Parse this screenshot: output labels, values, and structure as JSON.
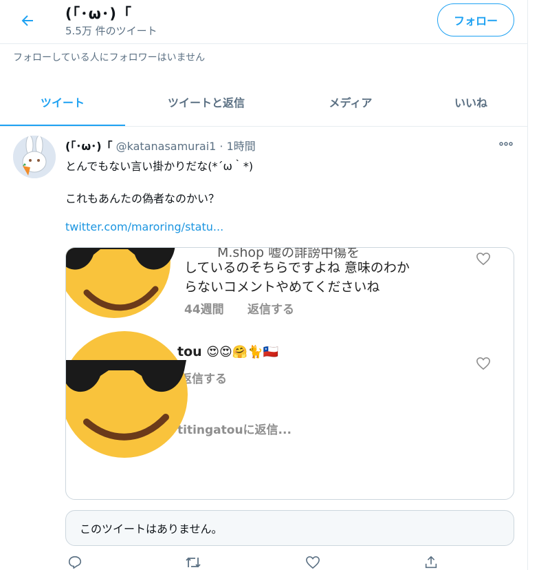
{
  "header": {
    "title": "(「･ω･)「",
    "tweet_count": "5.5万 件のツイート",
    "follow_label": "フォロー"
  },
  "followers_note": "フォローしている人にフォロワーはいません",
  "tabs": [
    {
      "label": "ツイート",
      "active": true
    },
    {
      "label": "ツイートと返信",
      "active": false
    },
    {
      "label": "メディア",
      "active": false
    },
    {
      "label": "いいね",
      "active": false
    }
  ],
  "tweet": {
    "author": "(「･ω･)「",
    "handle": "@katanasamurai1",
    "time": "1時間",
    "line1": "とんでもない言い掛かりだな(*´ω｀*)",
    "line2": "これもあんたの偽者なのかい？",
    "link": "twitter.com/maroring/statu...",
    "media": {
      "top_cut": "M.shop 嘘の誹謗中傷を",
      "comment_line1": "しているのそちらですよね 意味のわか",
      "comment_line2": "らないコメントやめてくださいね",
      "meta_time": "44週間",
      "reply1": "返信する",
      "user2": "tou",
      "reply2": "返信する",
      "reply_to": "titingatouに返信..."
    },
    "quote_unavailable": "このツイートはありません。"
  },
  "colors": {
    "accent": "#1da1f2",
    "link": "#1b95e0",
    "secondary_text": "#5b7083",
    "border": "#e6ecf0"
  },
  "icons": [
    "back-arrow-icon",
    "more-icon",
    "heart-icon",
    "reply-icon",
    "retweet-icon",
    "like-icon",
    "share-icon"
  ]
}
